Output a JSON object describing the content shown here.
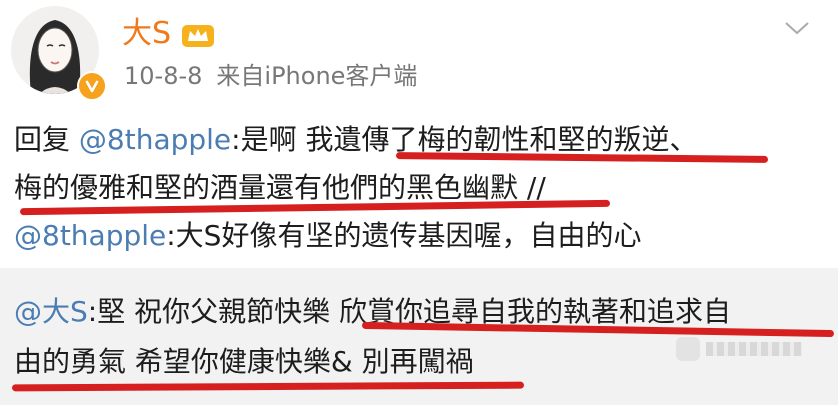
{
  "header": {
    "author": "大S",
    "date": "10-8-8",
    "source": "来自iPhone客户端",
    "icons": [
      "avatar",
      "vip-badge-icon",
      "crown-icon",
      "chevron-down-icon"
    ]
  },
  "post": {
    "line1": {
      "prefix": "回复 ",
      "mention": "@8thapple",
      "text": ":是啊 我遺傳了梅的韌性和堅的叛逆、"
    },
    "line2": {
      "text": "梅的優雅和堅的酒量還有他們的黑色幽默 //"
    },
    "line3": {
      "mention": "@8thapple",
      "text": ":大S好像有坚的遗传基因喔，自由的心"
    }
  },
  "repost": {
    "line1": {
      "mention": "@大S",
      "text": ":堅 祝你父親節快樂 欣賞你追尋自我的執著和追求自"
    },
    "line2": {
      "text": "由的勇氣 希望你健康快樂& 別再闖禍"
    }
  },
  "colors": {
    "name": "#f07a1a",
    "mention": "#4b7db3",
    "underline": "#d62020",
    "repost_bg": "#f2f2f2",
    "vip": "#f6a21c"
  }
}
